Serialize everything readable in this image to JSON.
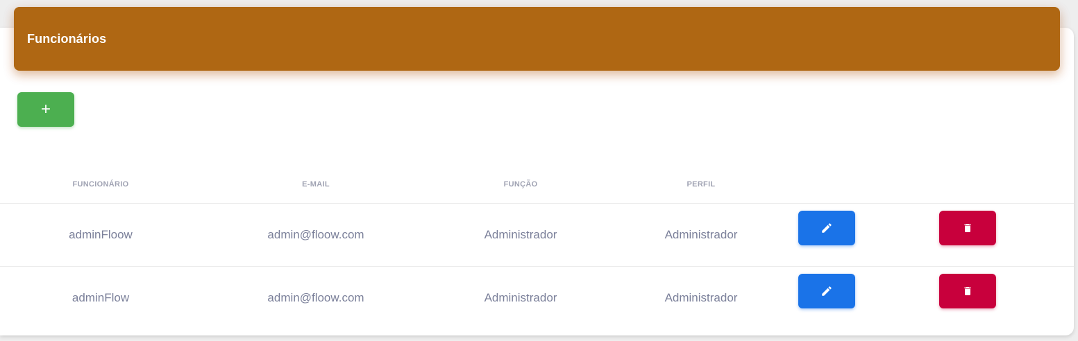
{
  "header": {
    "title": "Funcionários",
    "color": "#af6713"
  },
  "actions": {
    "add_label": "+",
    "add_color": "#4caf50",
    "edit_icon": "pencil-icon",
    "edit_color": "#1a73e8",
    "delete_icon": "trash-icon",
    "delete_color": "#c8003c"
  },
  "table": {
    "columns": [
      "FUNCIONÁRIO",
      "E-MAIL",
      "FUNÇÃO",
      "PERFIL"
    ],
    "rows": [
      {
        "funcionario": "adminFloow",
        "email": "admin@floow.com",
        "funcao": "Administrador",
        "perfil": "Administrador"
      },
      {
        "funcionario": "adminFlow",
        "email": "admin@floow.com",
        "funcao": "Administrador",
        "perfil": "Administrador"
      }
    ]
  }
}
